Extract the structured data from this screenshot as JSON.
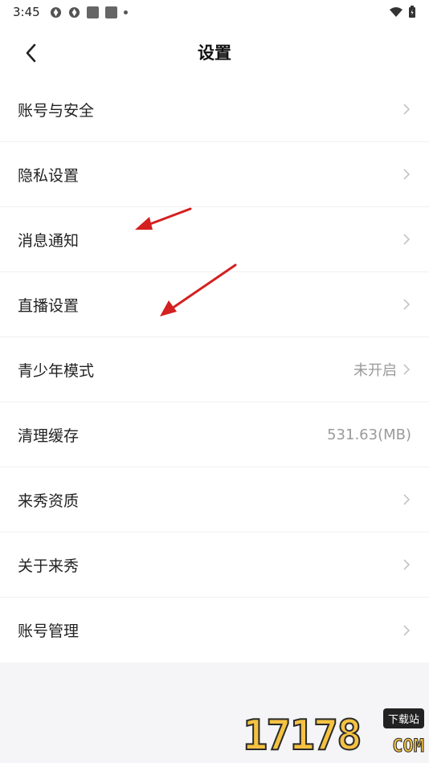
{
  "status_bar": {
    "time": "3:45"
  },
  "header": {
    "title": "设置"
  },
  "settings": [
    {
      "label": "账号与安全",
      "value": "",
      "chevron": true
    },
    {
      "label": "隐私设置",
      "value": "",
      "chevron": true
    },
    {
      "label": "消息通知",
      "value": "",
      "chevron": true
    },
    {
      "label": "直播设置",
      "value": "",
      "chevron": true
    },
    {
      "label": "青少年模式",
      "value": "未开启",
      "chevron": true
    },
    {
      "label": "清理缓存",
      "value": "531.63(MB)",
      "chevron": false
    },
    {
      "label": "来秀资质",
      "value": "",
      "chevron": true
    },
    {
      "label": "关于来秀",
      "value": "",
      "chevron": true
    },
    {
      "label": "账号管理",
      "value": "",
      "chevron": true
    }
  ],
  "watermark": {
    "digits": "17178",
    "badge": "下载站",
    "suffix": "COM"
  },
  "colors": {
    "arrow": "#d42020",
    "chevron": "#c4c4c4",
    "value_text": "#9a9a9a",
    "accent_watermark": "#f5c242"
  }
}
